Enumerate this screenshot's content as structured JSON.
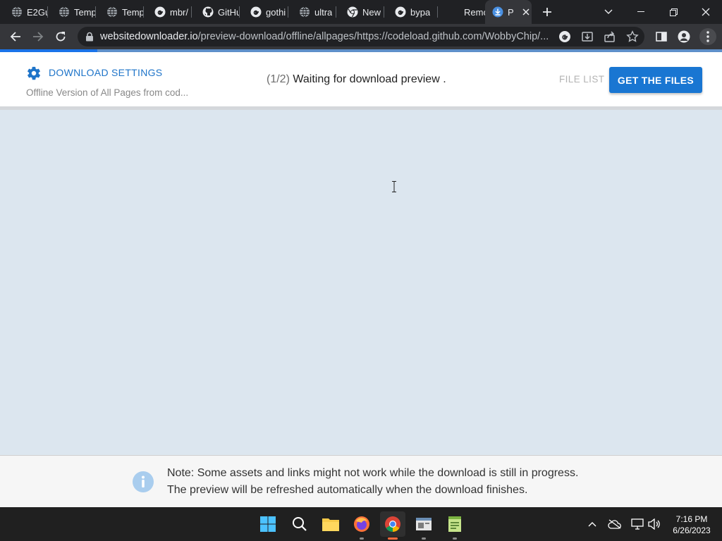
{
  "browser": {
    "tabs": [
      {
        "title": "E2Gu",
        "icon": "globe-icon"
      },
      {
        "title": "Temp",
        "icon": "globe-icon"
      },
      {
        "title": "Temp",
        "icon": "globe-icon"
      },
      {
        "title": "mbr/",
        "icon": "google-icon"
      },
      {
        "title": "GitHu",
        "icon": "github-icon"
      },
      {
        "title": "gothi",
        "icon": "google-icon"
      },
      {
        "title": "ultra",
        "icon": "globe-icon"
      },
      {
        "title": "New",
        "icon": "chrome-icon"
      },
      {
        "title": "bypa",
        "icon": "google-icon"
      },
      {
        "title": "Remo",
        "icon": "blank-icon"
      },
      {
        "title": "Pi",
        "icon": "download-icon",
        "active": true
      }
    ],
    "url_host": "websitedownloader.io",
    "url_path": "/preview-download/offline/allpages/https://codeload.github.com/WobbyChip/...",
    "load_progress": 0.135
  },
  "header": {
    "settings_label": "DOWNLOAD SETTINGS",
    "settings_subtitle": "Offline Version of All Pages from cod...",
    "status_step": "(1/2)",
    "status_text": "Waiting for download preview .",
    "file_list_label": "FILE LIST",
    "get_files_label": "GET THE FILES"
  },
  "note": {
    "line1": "Note: Some assets and links might not work while the download is still in progress.",
    "line2": "The preview will be refreshed automatically when the download finishes."
  },
  "taskbar": {
    "apps": [
      "start-icon",
      "search-icon",
      "file-explorer-icon",
      "firefox-icon",
      "chrome-icon",
      "app-icon",
      "notepad-icon"
    ],
    "time": "7:16 PM",
    "date": "6/26/2023"
  },
  "colors": {
    "accent": "#1976d2",
    "settings_blue": "#1e74c9",
    "preview_bg": "#dce6ef",
    "info_blue": "#a9cdee"
  }
}
